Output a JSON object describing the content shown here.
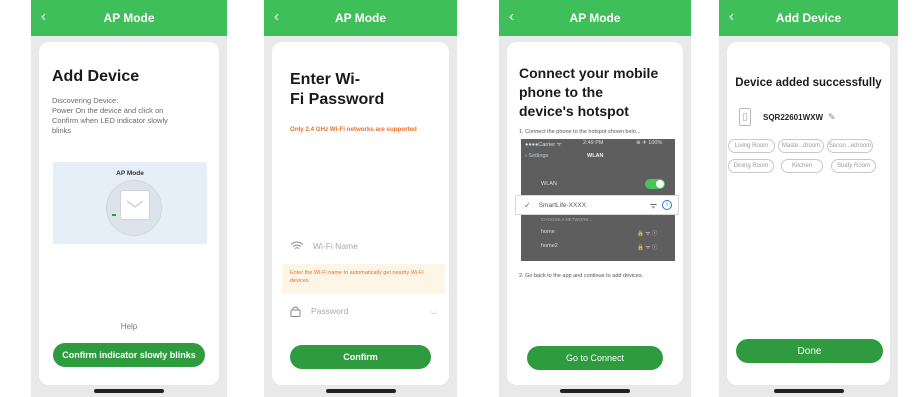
{
  "colors": {
    "topbar": "#3fbf5a",
    "button": "#2e9b3f",
    "warning": "#e8702a"
  },
  "screens": [
    {
      "title": "AP Mode",
      "heading": "Add Device",
      "description": [
        "Discovering Device:",
        "Power On the device and click on",
        "Confirm when LED indicator slowly",
        "blinks"
      ],
      "illustration_label": "AP Mode",
      "help": "Help",
      "button": "Confirm indicator slowly blinks"
    },
    {
      "title": "AP Mode",
      "heading_line1": "Enter Wi-",
      "heading_line2": "Fi Password",
      "warning": "Only 2.4 GHz Wi-Fi networks are supported",
      "wifi_placeholder": "Wi-Fi Name",
      "hint": "Enter the Wi-Fi name to automatically get nearby Wi-Fi devices.",
      "password_placeholder": "Password",
      "button": "Confirm"
    },
    {
      "title": "AP Mode",
      "heading_line1": "Connect your mobile",
      "heading_line2": "phone to the",
      "heading_line3": "device's hotspot",
      "step1": "1. Connect the phone to the hotspot shown belo...",
      "status_carrier": "●●●●Carrier ᯤ",
      "status_time": "2:49 PM",
      "status_battery": "⊕ ✈ 100%",
      "settings_back": "Settings",
      "settings_title": "WLAN",
      "wlan_label": "WLAN",
      "network_selected": "SmartLife-XXXX",
      "choose_network": "CHOOSE A NETWORK...",
      "network_1": "home",
      "network_2": "home2",
      "step2": "2. Go back to the app and continue to add devices.",
      "button": "Go to Connect"
    },
    {
      "title": "Add Device",
      "heading": "Device added successfully",
      "device_name": "SQR22601WXW",
      "rooms": [
        "Living Room",
        "Maste...droom",
        "Secon...edroom",
        "Dining Room",
        "Kitchen",
        "Study Room"
      ],
      "button": "Done"
    }
  ]
}
